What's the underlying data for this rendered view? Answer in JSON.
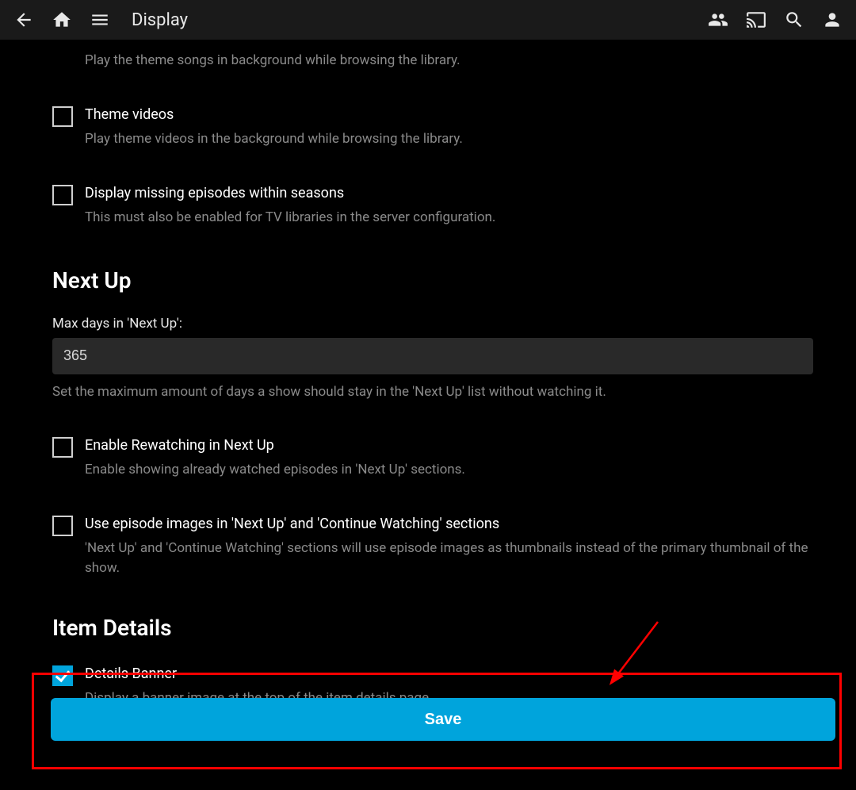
{
  "header": {
    "title": "Display"
  },
  "intro_desc": "Play the theme songs in background while browsing the library.",
  "options": {
    "theme_videos": {
      "label": "Theme videos",
      "desc": "Play theme videos in the background while browsing the library.",
      "checked": false
    },
    "missing_episodes": {
      "label": "Display missing episodes within seasons",
      "desc": "This must also be enabled for TV libraries in the server configuration.",
      "checked": false
    }
  },
  "next_up": {
    "heading": "Next Up",
    "max_days_label": "Max days in 'Next Up':",
    "max_days_value": "365",
    "max_days_desc": "Set the maximum amount of days a show should stay in the 'Next Up' list without watching it.",
    "rewatching": {
      "label": "Enable Rewatching in Next Up",
      "desc": "Enable showing already watched episodes in 'Next Up' sections.",
      "checked": false
    },
    "episode_images": {
      "label": "Use episode images in 'Next Up' and 'Continue Watching' sections",
      "desc": "'Next Up' and 'Continue Watching' sections will use episode images as thumbnails instead of the primary thumbnail of the show.",
      "checked": false
    }
  },
  "item_details": {
    "heading": "Item Details",
    "details_banner": {
      "label": "Details Banner",
      "desc": "Display a banner image at the top of the item details page.",
      "checked": true
    }
  },
  "save_label": "Save"
}
